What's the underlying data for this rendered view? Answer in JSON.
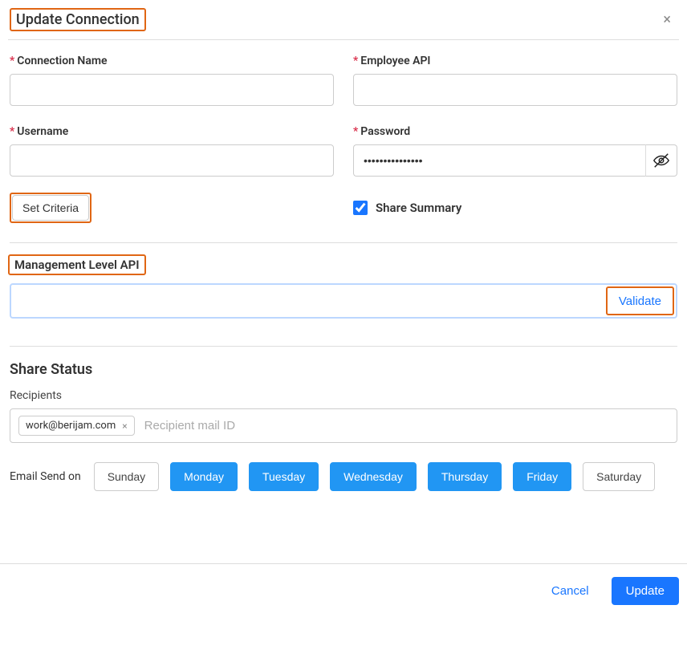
{
  "header": {
    "title": "Update Connection",
    "close_icon": "×"
  },
  "fields": {
    "connection_name": {
      "label": "Connection Name",
      "value": "      "
    },
    "employee_api": {
      "label": "Employee API",
      "value": "                                                  "
    },
    "username": {
      "label": "Username",
      "value": "           "
    },
    "password": {
      "label": "Password",
      "value": "•••••••••••••••"
    }
  },
  "set_criteria_label": "Set Criteria",
  "share_summary": {
    "label": "Share Summary",
    "checked": true
  },
  "mgmt": {
    "title": "Management Level API",
    "value": "                                                                                                           ",
    "validate_label": "Validate"
  },
  "share_status": {
    "heading": "Share Status",
    "recipients_label": "Recipients",
    "recipient_tag": "work@berijam.com",
    "recipient_placeholder": "Recipient mail ID"
  },
  "days": {
    "label": "Email Send on",
    "items": [
      {
        "name": "Sunday",
        "selected": false
      },
      {
        "name": "Monday",
        "selected": true
      },
      {
        "name": "Tuesday",
        "selected": true
      },
      {
        "name": "Wednesday",
        "selected": true
      },
      {
        "name": "Thursday",
        "selected": true
      },
      {
        "name": "Friday",
        "selected": true
      },
      {
        "name": "Saturday",
        "selected": false
      }
    ]
  },
  "footer": {
    "cancel": "Cancel",
    "update": "Update"
  }
}
